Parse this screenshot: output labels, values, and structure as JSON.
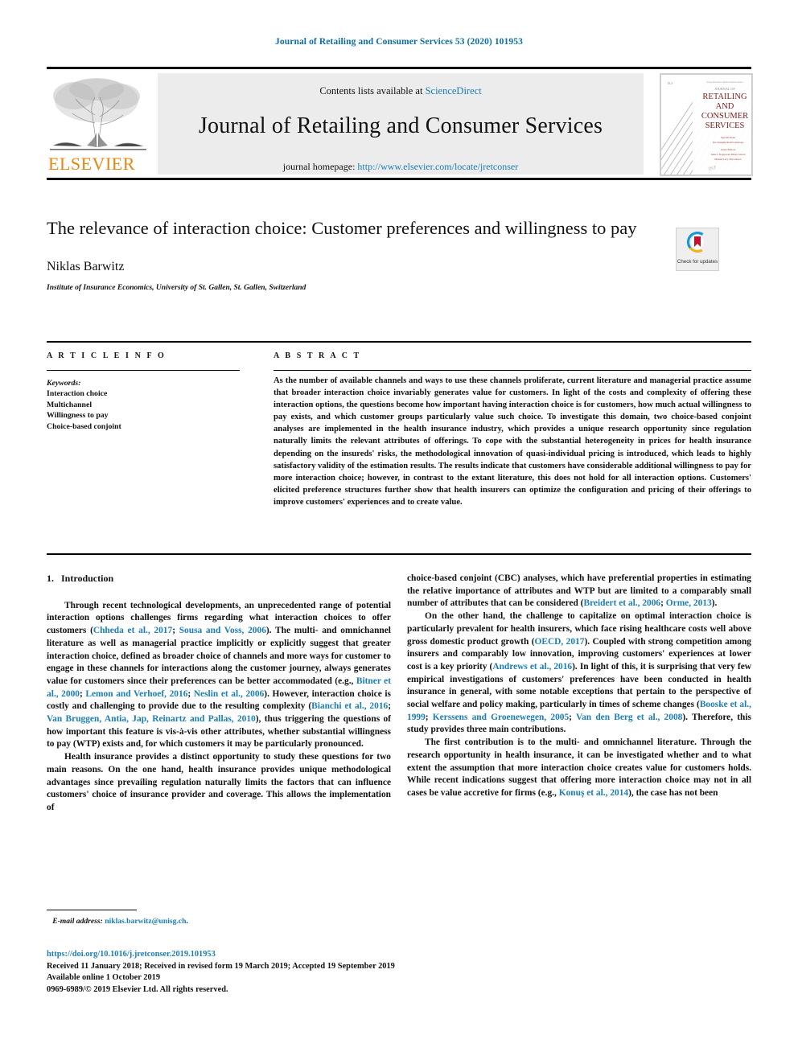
{
  "running_head": "Journal of Retailing and Consumer Services 53 (2020) 101953",
  "masthead": {
    "publisher": "ELSEVIER",
    "contents_prefix": "Contents lists available at",
    "contents_link": "ScienceDirect",
    "journal_title": "Journal of Retailing and Consumer Services",
    "homepage_prefix": "journal homepage:",
    "homepage_url": "http://www.elsevier.com/locate/jretconser",
    "cover": {
      "line1": "JOURNAL OF",
      "line2": "RETAILING",
      "line3": "AND",
      "line4": "CONSUMER",
      "line5": "SERVICES"
    }
  },
  "article": {
    "title": "The relevance of interaction choice: Customer preferences and willingness to pay",
    "author": "Niklas Barwitz",
    "affiliation": "Institute of Insurance Economics, University of St. Gallen, St. Gallen, Switzerland",
    "crossmark_label": "Check for updates"
  },
  "info": {
    "heading": "A R T I C L E   I N F O",
    "keywords_heading": "Keywords:",
    "keywords": [
      "Interaction choice",
      "Multichannel",
      "Willingness to pay",
      "Choice-based conjoint"
    ]
  },
  "abstract": {
    "heading": "A B S T R A C T",
    "text": "As the number of available channels and ways to use these channels proliferate, current literature and managerial practice assume that broader interaction choice invariably generates value for customers. In light of the costs and complexity of offering these interaction options, the questions become how important having interaction choice is for customers, how much actual willingness to pay exists, and which customer groups particularly value such choice. To investigate this domain, two choice-based conjoint analyses are implemented in the health insurance industry, which provides a unique research opportunity since regulation naturally limits the relevant attributes of offerings. To cope with the substantial heterogeneity in prices for health insurance depending on the insureds' risks, the methodological innovation of quasi-individual pricing is introduced, which leads to highly satisfactory validity of the estimation results. The results indicate that customers have considerable additional willingness to pay for more interaction choice; however, in contrast to the extant literature, this does not hold for all interaction options. Customers' elicited preference structures further show that health insurers can optimize the configuration and pricing of their offerings to improve customers' experiences and to create value."
  },
  "body": {
    "section_number": "1.",
    "section_title": "Introduction",
    "left_paragraphs": [
      "Through recent technological developments, an unprecedented range of potential interaction options challenges firms regarding what interaction choices to offer customers (<span class=\"ref\">Chheda et al., 2017</span>; <span class=\"ref\">Sousa and Voss, 2006</span>). The multi- and omnichannel literature as well as managerial practice implicitly or explicitly suggest that greater interaction choice, defined as broader choice of channels and more ways for customer to engage in these channels for interactions along the customer journey, always generates value for customers since their preferences can be better accommodated (e.g., <span class=\"ref\">Bitner et al., 2000</span>; <span class=\"ref\">Lemon and Verhoef, 2016</span>; <span class=\"ref\">Neslin et al., 2006</span>). However, interaction choice is costly and challenging to provide due to the resulting complexity (<span class=\"ref\">Bianchi et al., 2016</span>; <span class=\"ref\">Van Bruggen, Antia, Jap, Reinartz and Pallas, 2010</span>), thus triggering the questions of how important this feature is vis-à-vis other attributes, whether substantial willingness to pay (WTP) exists and, for which customers it may be particularly pronounced.",
      "Health insurance provides a distinct opportunity to study these questions for two main reasons. On the one hand, health insurance provides unique methodological advantages since prevailing regulation naturally limits the factors that can influence customers' choice of insurance provider and coverage. This allows the implementation of"
    ],
    "right_paragraphs": [
      "choice-based conjoint (CBC) analyses, which have preferential properties in estimating the relative importance of attributes and WTP but are limited to a comparably small number of attributes that can be considered (<span class=\"ref\">Breidert et al., 2006</span>; <span class=\"ref\">Orme, 2013</span>).",
      "On the other hand, the challenge to capitalize on optimal interaction choice is particularly prevalent for health insurers, which face rising healthcare costs well above gross domestic product growth (<span class=\"ref\">OECD, 2017</span>). Coupled with strong competition among insurers and comparably low innovation, improving customers' experiences at lower cost is a key priority (<span class=\"ref\">Andrews et al., 2016</span>). In light of this, it is surprising that very few empirical investigations of customers' preferences have been conducted in health insurance in general, with some notable exceptions that pertain to the perspective of social welfare and policy making, particularly in times of scheme changes (<span class=\"ref\">Booske et al., 1999</span>; <span class=\"ref\">Kerssens and Groenewegen, 2005</span>; <span class=\"ref\">Van den Berg et al., 2008</span>). Therefore, this study provides three main contributions.",
      "The first contribution is to the multi- and omnichannel literature. Through the research opportunity in health insurance, it can be investigated whether and to what extent the assumption that more interaction choice creates value for customers holds. While recent indications suggest that offering more interaction choice may not in all cases be value accretive for firms (e.g., <span class=\"ref\">Konuş et al., 2014</span>), the case has not been"
    ]
  },
  "footnote": {
    "label": "E-mail address:",
    "email": "niklas.barwitz@unisg.ch",
    "trailing": "."
  },
  "footer": {
    "doi": "https://doi.org/10.1016/j.jretconser.2019.101953",
    "dates": "Received 11 January 2018; Received in revised form 19 March 2019; Accepted 19 September 2019",
    "available": "Available online 1 October 2019",
    "copyright": "0969-6989/© 2019 Elsevier Ltd. All rights reserved."
  },
  "colors": {
    "link": "#1a7db6",
    "elsevier_orange": "#e8860c",
    "band": "#ececec"
  }
}
